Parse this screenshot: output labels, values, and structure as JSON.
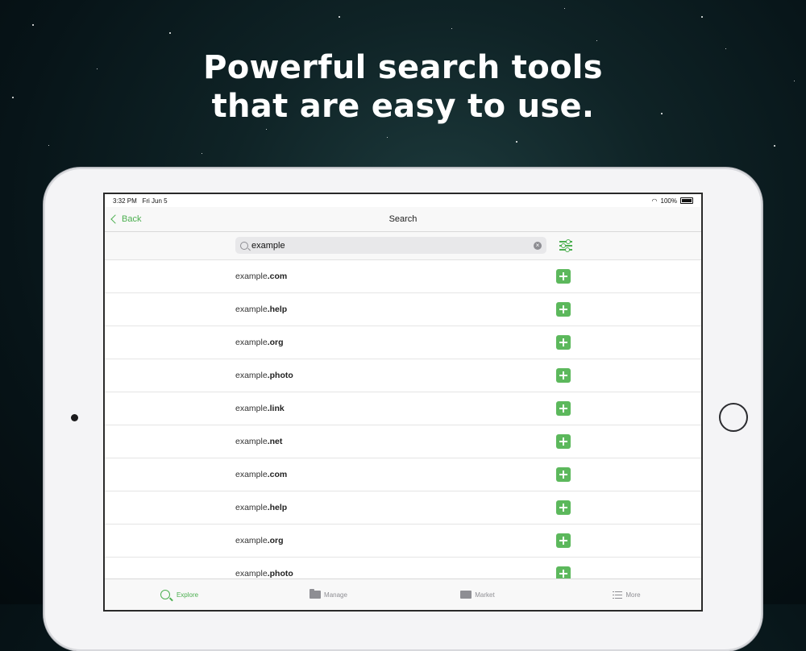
{
  "hero": {
    "line1": "Powerful search tools",
    "line2": "that are easy to use."
  },
  "status_bar": {
    "time": "3:32 PM",
    "date": "Fri Jun 5",
    "battery": "100%"
  },
  "nav": {
    "back_label": "Back",
    "title": "Search"
  },
  "search": {
    "value": "example",
    "clear_icon": "clear-icon",
    "filter_icon": "filter-sliders-icon"
  },
  "results": [
    {
      "name": "example",
      "tld": ".com"
    },
    {
      "name": "example",
      "tld": ".help"
    },
    {
      "name": "example",
      "tld": ".org"
    },
    {
      "name": "example",
      "tld": ".photo"
    },
    {
      "name": "example",
      "tld": ".link"
    },
    {
      "name": "example",
      "tld": ".net"
    },
    {
      "name": "example",
      "tld": ".com"
    },
    {
      "name": "example",
      "tld": ".help"
    },
    {
      "name": "example",
      "tld": ".org"
    },
    {
      "name": "example",
      "tld": ".photo"
    }
  ],
  "tabs": [
    {
      "label": "Explore",
      "icon": "search-icon",
      "active": true
    },
    {
      "label": "Manage",
      "icon": "folder-icon",
      "active": false
    },
    {
      "label": "Market",
      "icon": "store-icon",
      "active": false
    },
    {
      "label": "More",
      "icon": "list-icon",
      "active": false
    }
  ],
  "colors": {
    "accent": "#4caf50",
    "add_button": "#5cb85c"
  }
}
